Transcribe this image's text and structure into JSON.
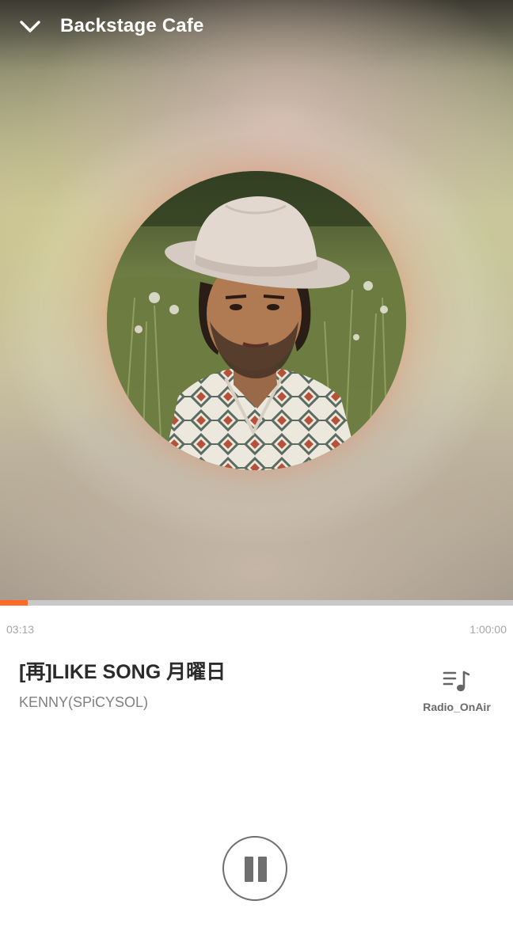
{
  "header": {
    "station_name": "Backstage Cafe",
    "back_icon": "chevron-down-icon"
  },
  "artwork": {
    "icon": "album-art-portrait"
  },
  "progress": {
    "elapsed": "03:13",
    "total": "1:00:00",
    "fraction": 0.0536,
    "fill_color": "#ff6a2a",
    "track_color": "#c8c8c8"
  },
  "track": {
    "title": "[再]LIKE SONG 月曜日",
    "artist": "KENNY(SPiCYSOL)"
  },
  "onair": {
    "label": "Radio_OnAir",
    "icon": "playlist-music-icon"
  },
  "controls": {
    "play_state_icon": "pause-icon"
  }
}
